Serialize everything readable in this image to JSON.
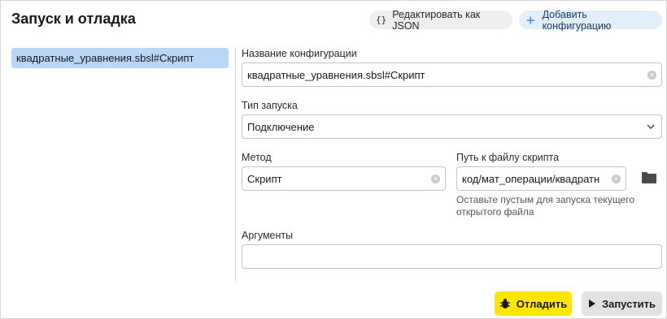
{
  "title": "Запуск и отладка",
  "toolbar": {
    "edit_json_icon": "{}",
    "edit_json_label": "Редактировать как JSON",
    "add_config_icon": "+",
    "add_config_label": "Добавить конфигурацию"
  },
  "sidebar": {
    "items": [
      {
        "label": "квадратные_уравнения.sbsl#Скрипт",
        "selected": true
      }
    ]
  },
  "form": {
    "config_name": {
      "label": "Название конфигурации",
      "value": "квадратные_уравнения.sbsl#Скрипт"
    },
    "launch_type": {
      "label": "Тип запуска",
      "value": "Подключение"
    },
    "method": {
      "label": "Метод",
      "value": "Скрипт"
    },
    "script_path": {
      "label": "Путь к файлу скрипта",
      "value": "код/мат_операции/квадратн",
      "hint": "Оставьте пустым для запуска текущего открытого файла"
    },
    "arguments": {
      "label": "Аргументы",
      "value": ""
    }
  },
  "buttons": {
    "debug_label": "Отладить",
    "run_label": "Запустить"
  },
  "icons": {
    "clear": "clear-icon",
    "dropdown": "chevron-down-icon",
    "folder": "folder-icon",
    "debug": "bug-icon",
    "run": "play-icon"
  },
  "colors": {
    "selection": "#b8d6f6",
    "debug_button": "#ffe500",
    "run_button": "#e2e2e2",
    "add_accent": "#2f7de1"
  }
}
